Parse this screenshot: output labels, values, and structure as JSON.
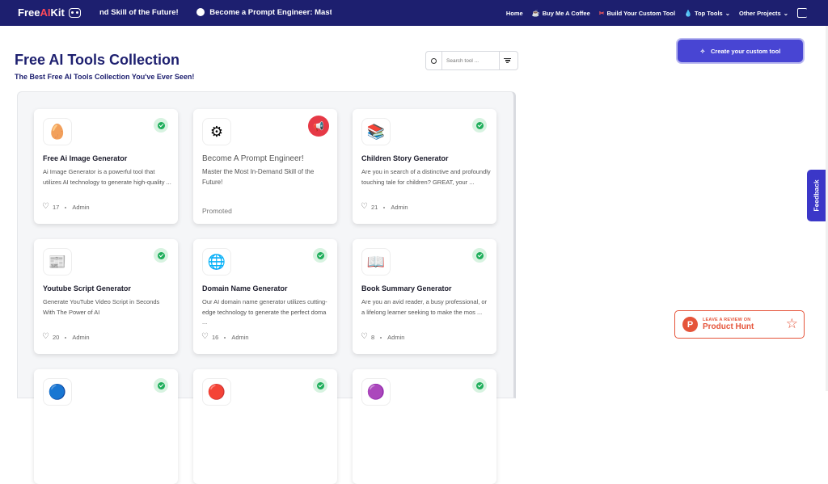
{
  "header": {
    "logo_prefix": "Free",
    "logo_ai": "AI",
    "logo_suffix": "Kit",
    "ticker": [
      "nd Skill of the Future!",
      "Become a Prompt Engineer: Master the M"
    ],
    "nav": [
      {
        "label": "Home",
        "icon": ""
      },
      {
        "label": "Buy Me A Coffee",
        "icon": "☕"
      },
      {
        "label": "Build Your Custom Tool",
        "icon": "✂"
      },
      {
        "label": "Top Tools",
        "icon": "💧",
        "dropdown": true
      },
      {
        "label": "Other Projects",
        "icon": "",
        "dropdown": true
      }
    ]
  },
  "page": {
    "title": "Free AI Tools Collection",
    "subtitle": "The Best Free AI Tools Collection You've Ever Seen!",
    "search_placeholder": "Search tool ..."
  },
  "cards": [
    {
      "name": "Free Ai Image Generator",
      "desc": "Ai Image Generator is a powerful tool that utilizes AI technology to generate high-quality ...",
      "likes": "17",
      "author": "Admin",
      "icon": "🥚",
      "verified": true
    },
    {
      "name": "Become A Prompt Engineer!",
      "desc": "Master the Most In-Demand Skill of the Future!",
      "promoted": "Promoted",
      "icon": "⚙",
      "promo": true
    },
    {
      "name": "Children Story Generator",
      "desc": "Are you in search of a distinctive and profoundly touching tale for children? GREAT, your ...",
      "likes": "21",
      "author": "Admin",
      "icon": "📚",
      "verified": true
    },
    {
      "name": "Youtube Script Generator",
      "desc": "Generate YouTube Video Script in Seconds With The Power of AI",
      "likes": "20",
      "author": "Admin",
      "icon": "📰",
      "verified": true
    },
    {
      "name": "Domain Name Generator",
      "desc": "Our AI domain name generator utilizes cutting-edge technology to generate the perfect doma ...",
      "likes": "16",
      "author": "Admin",
      "icon": "🌐",
      "verified": true
    },
    {
      "name": "Book Summary Generator",
      "desc": "Are you an avid reader, a busy professional, or a lifelong learner seeking to make the mos ...",
      "likes": "8",
      "author": "Admin",
      "icon": "📖",
      "verified": true
    },
    {
      "icon": "🔵",
      "verified": true
    },
    {
      "icon": "🔴",
      "verified": true
    },
    {
      "icon": "🟣",
      "verified": true
    }
  ],
  "sidebar": {
    "create_label": "Create your custom tool",
    "feedback_label": "Feedback",
    "ph_small": "LEAVE A REVIEW ON",
    "ph_big": "Product Hunt",
    "ph_letter": "P"
  },
  "colors": {
    "navy": "#1d1f6f",
    "accent": "#4845d3",
    "success": "#1fae5b",
    "producthunt": "#e5543a"
  }
}
